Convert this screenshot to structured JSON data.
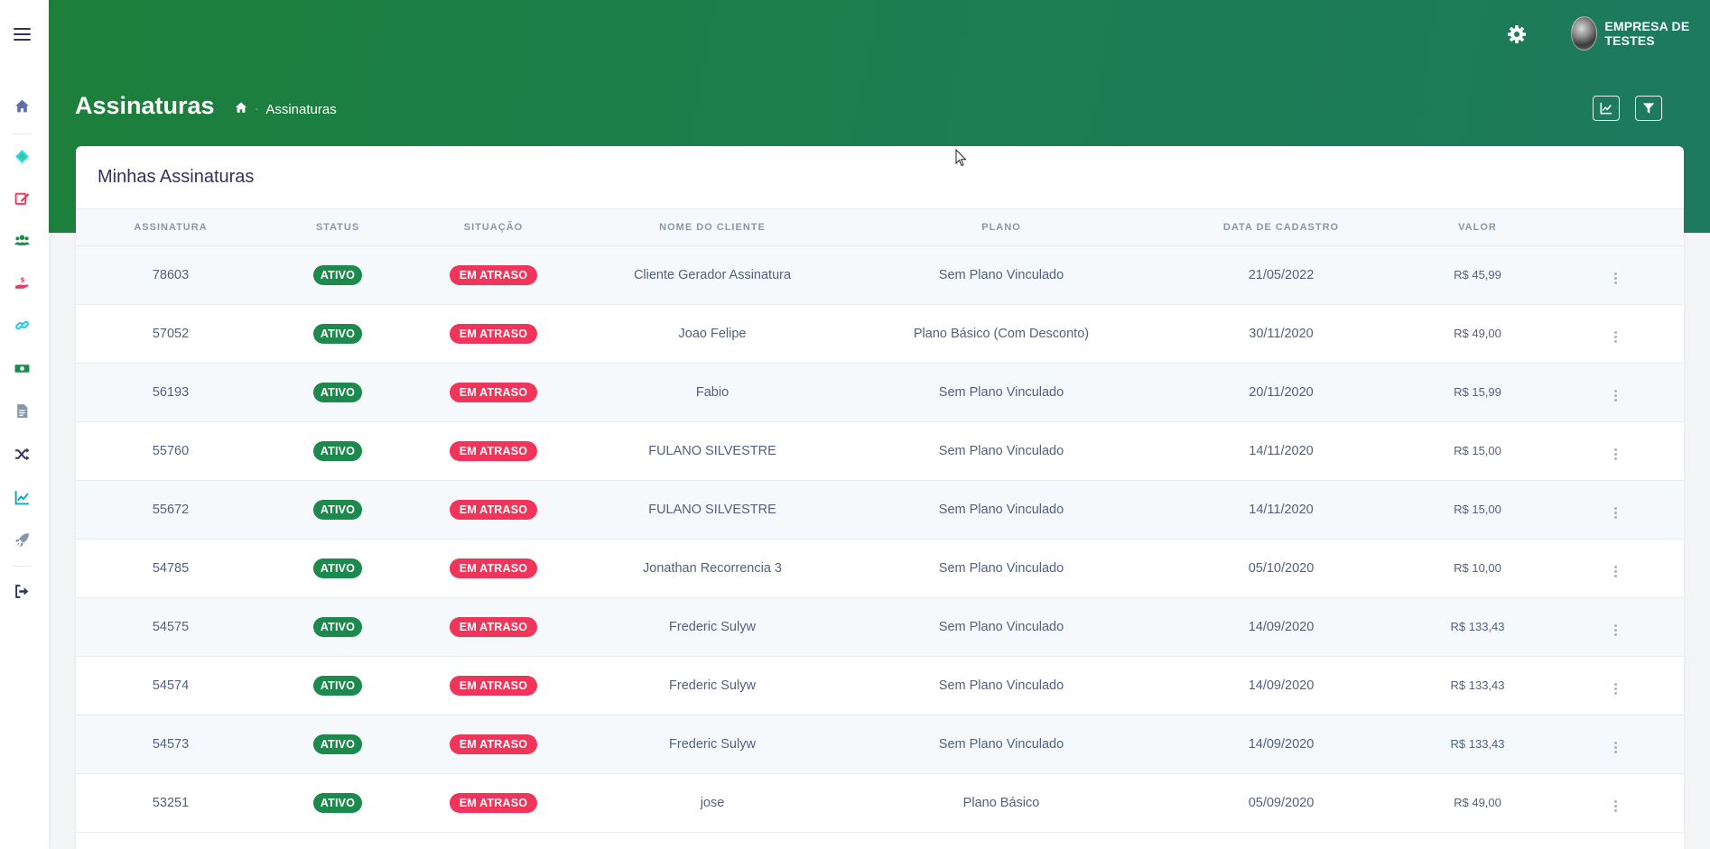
{
  "header": {
    "company": "EMPRESA DE TESTES",
    "page_title": "Assinaturas",
    "breadcrumb": [
      "Assinaturas"
    ]
  },
  "sidebar": {
    "icons": [
      "menu-icon",
      "home-icon",
      "tag-icon",
      "edit-icon",
      "users-icon",
      "hand-money-icon",
      "link-icon",
      "money-bill-icon",
      "file-icon",
      "shuffle-icon",
      "chart-line-icon",
      "rocket-icon",
      "sign-out-icon"
    ]
  },
  "colors": {
    "brand": "#1d7f3a",
    "active_badge": "#1b8a4c",
    "late_badge": "#f0345a"
  },
  "card": {
    "title": "Minhas Assinaturas",
    "columns": [
      "ASSINATURA",
      "STATUS",
      "SITUAÇÃO",
      "NOME DO CLIENTE",
      "PLANO",
      "DATA DE CADASTRO",
      "VALOR",
      ""
    ],
    "rows": [
      {
        "id": "78603",
        "status": "ATIVO",
        "situacao": "EM ATRASO",
        "cliente": "Cliente Gerador Assinatura",
        "plano": "Sem Plano Vinculado",
        "data": "21/05/2022",
        "valor": "R$ 45,99"
      },
      {
        "id": "57052",
        "status": "ATIVO",
        "situacao": "EM ATRASO",
        "cliente": "Joao Felipe",
        "plano": "Plano Básico (Com Desconto)",
        "data": "30/11/2020",
        "valor": "R$ 49,00"
      },
      {
        "id": "56193",
        "status": "ATIVO",
        "situacao": "EM ATRASO",
        "cliente": "Fabio",
        "plano": "Sem Plano Vinculado",
        "data": "20/11/2020",
        "valor": "R$ 15,99"
      },
      {
        "id": "55760",
        "status": "ATIVO",
        "situacao": "EM ATRASO",
        "cliente": "FULANO SILVESTRE",
        "plano": "Sem Plano Vinculado",
        "data": "14/11/2020",
        "valor": "R$ 15,00"
      },
      {
        "id": "55672",
        "status": "ATIVO",
        "situacao": "EM ATRASO",
        "cliente": "FULANO SILVESTRE",
        "plano": "Sem Plano Vinculado",
        "data": "14/11/2020",
        "valor": "R$ 15,00"
      },
      {
        "id": "54785",
        "status": "ATIVO",
        "situacao": "EM ATRASO",
        "cliente": "Jonathan Recorrencia 3",
        "plano": "Sem Plano Vinculado",
        "data": "05/10/2020",
        "valor": "R$ 10,00"
      },
      {
        "id": "54575",
        "status": "ATIVO",
        "situacao": "EM ATRASO",
        "cliente": "Frederic Sulyw",
        "plano": "Sem Plano Vinculado",
        "data": "14/09/2020",
        "valor": "R$ 133,43"
      },
      {
        "id": "54574",
        "status": "ATIVO",
        "situacao": "EM ATRASO",
        "cliente": "Frederic Sulyw",
        "plano": "Sem Plano Vinculado",
        "data": "14/09/2020",
        "valor": "R$ 133,43"
      },
      {
        "id": "54573",
        "status": "ATIVO",
        "situacao": "EM ATRASO",
        "cliente": "Frederic Sulyw",
        "plano": "Sem Plano Vinculado",
        "data": "14/09/2020",
        "valor": "R$ 133,43"
      },
      {
        "id": "53251",
        "status": "ATIVO",
        "situacao": "EM ATRASO",
        "cliente": "jose",
        "plano": "Plano Básico",
        "data": "05/09/2020",
        "valor": "R$ 49,00"
      }
    ]
  }
}
